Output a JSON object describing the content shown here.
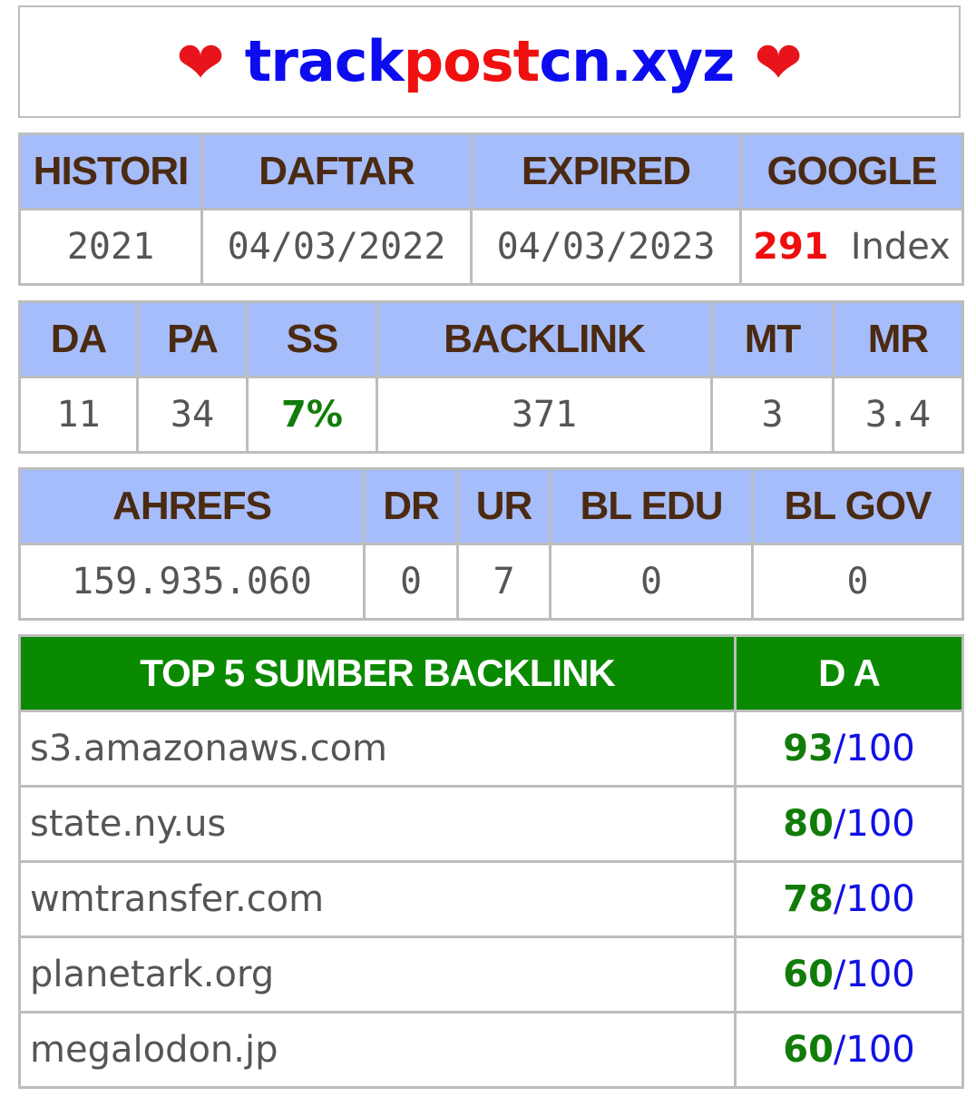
{
  "site": {
    "heart_left": "❤",
    "domain_part1": "track",
    "domain_part2": "post",
    "domain_part3": "cn.xyz",
    "heart_right": "❤"
  },
  "table1": {
    "headers": [
      "HISTORI",
      "DAFTAR",
      "EXPIRED",
      "GOOGLE"
    ],
    "histori": "2021",
    "daftar": "04/03/2022",
    "expired": "04/03/2023",
    "google_count": "291",
    "google_unit": "Index"
  },
  "table2": {
    "headers": [
      "DA",
      "PA",
      "SS",
      "BACKLINK",
      "MT",
      "MR"
    ],
    "values": [
      "11",
      "34",
      "7%",
      "371",
      "3",
      "3.4"
    ]
  },
  "table3": {
    "headers": [
      "AHREFS",
      "DR",
      "UR",
      "BL EDU",
      "BL GOV"
    ],
    "values": [
      "159.935.060",
      "0",
      "7",
      "0",
      "0"
    ]
  },
  "top_backlinks": {
    "header_source": "TOP 5 SUMBER BACKLINK",
    "header_da": "D A",
    "max": "/100",
    "rows": [
      {
        "domain": "s3.amazonaws.com",
        "da": "93"
      },
      {
        "domain": "state.ny.us",
        "da": "80"
      },
      {
        "domain": "wmtransfer.com",
        "da": "78"
      },
      {
        "domain": "planetark.org",
        "da": "60"
      },
      {
        "domain": "megalodon.jp",
        "da": "60"
      }
    ]
  },
  "colors": {
    "header_bg": "#a6bdfb",
    "header_text": "#4b2a12",
    "green_header": "#0a8a00",
    "accent_blue": "#0c0cef",
    "accent_red": "#f01010",
    "score_green": "#127c0a"
  }
}
